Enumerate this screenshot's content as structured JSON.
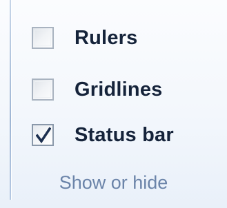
{
  "group": {
    "title": "Show or hide",
    "options": [
      {
        "label": "Rulers",
        "checked": false
      },
      {
        "label": "Gridlines",
        "checked": false
      },
      {
        "label": "Status bar",
        "checked": true
      }
    ]
  },
  "icons": {
    "checkbox": "checkbox-icon",
    "checkmark": "checkmark-icon"
  },
  "colors": {
    "label_text": "#15233a",
    "group_title_text": "#6b84a9",
    "panel_background": "#f3f7fc",
    "checkbox_border": "#a9b3c0",
    "checkmark": "#1c2f4f"
  }
}
